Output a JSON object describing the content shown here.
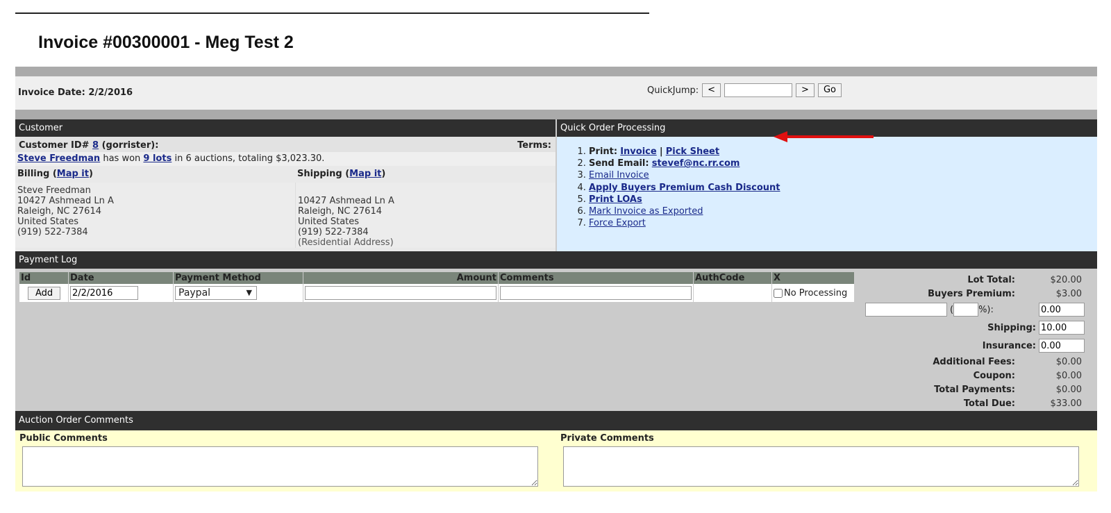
{
  "page": {
    "title": "Invoice #00300001 - Meg Test 2"
  },
  "datebar": {
    "invoice_date": "Invoice Date: 2/2/2016",
    "quickjump_label": "QuickJump:",
    "prev": "<",
    "next": ">",
    "go": "Go"
  },
  "customer": {
    "heading": "Customer",
    "id_prefix": "Customer ID#",
    "id": "8",
    "username": "(gorrister):",
    "terms": "Terms:",
    "name": "Steve Freedman",
    "won_text1": "has won",
    "lots": "9 lots",
    "won_text2": "in 6 auctions, totaling $3,023.30.",
    "billing_label": "Billing (",
    "shipping_label": "Shipping (",
    "map_it": "Map it",
    "paren_close": ")",
    "billing": [
      "Steve Freedman",
      "10427 Ashmead Ln A",
      "Raleigh, NC 27614",
      "United States",
      "(919) 522-7384"
    ],
    "shipping": [
      "",
      "10427 Ashmead Ln A",
      "Raleigh, NC 27614",
      "United States",
      "(919) 522-7384"
    ],
    "shipping_note": "(Residential Address)"
  },
  "qop": {
    "heading": "Quick Order Processing",
    "print_label": "Print:",
    "invoice_link": "Invoice",
    "sep": "|",
    "pick_sheet": "Pick Sheet",
    "send_email_label": "Send Email:",
    "email": "stevef@nc.rr.com",
    "email_invoice": "Email Invoice",
    "apply_premium": "Apply Buyers Premium Cash Discount",
    "print_loas": "Print LOAs",
    "mark_exported": "Mark Invoice as Exported",
    "force_export": "Force Export",
    "arrow_color": "#e01010"
  },
  "paylog": {
    "heading": "Payment Log",
    "columns": [
      "Id",
      "Date",
      "Payment Method",
      "Amount",
      "Comments",
      "AuthCode",
      "X"
    ],
    "add": "Add",
    "date_value": "2/2/2016",
    "method": "Paypal",
    "no_processing": "No Processing"
  },
  "totals": {
    "lot_total_label": "Lot Total:",
    "lot_total": "$20.00",
    "buyers_premium_label": "Buyers Premium:",
    "buyers_premium": "$3.00",
    "discount_open": "(",
    "discount_close": "%):",
    "discount_value": "0.00",
    "shipping_label": "Shipping:",
    "shipping": "10.00",
    "insurance_label": "Insurance:",
    "insurance": "0.00",
    "fees_label": "Additional Fees:",
    "fees": "$0.00",
    "coupon_label": "Coupon:",
    "coupon": "$0.00",
    "payments_label": "Total Payments:",
    "payments": "$0.00",
    "due_label": "Total Due:",
    "due": "$33.00"
  },
  "comments": {
    "heading": "Auction Order Comments",
    "public": "Public Comments",
    "private": "Private Comments"
  }
}
